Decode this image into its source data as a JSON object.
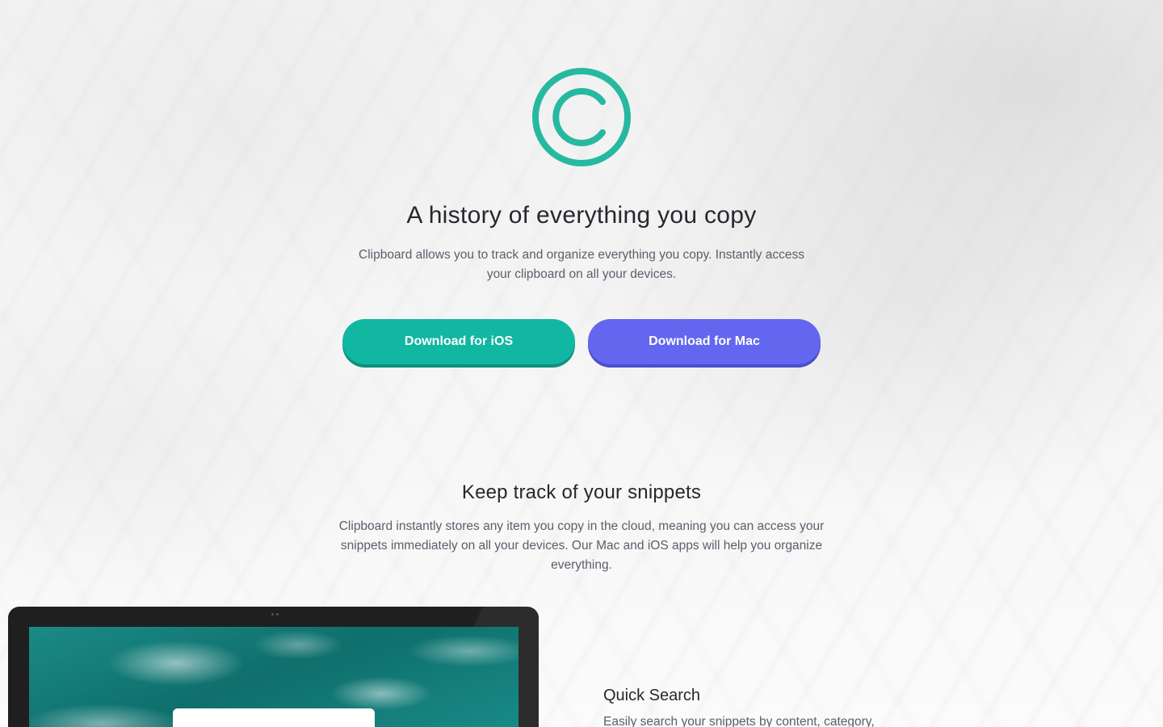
{
  "hero": {
    "logo_icon": "copyright-c-icon",
    "title": "A history of everything you copy",
    "subtitle": "Clipboard allows you to track and organize everything you copy. Instantly access your clipboard on all your devices.",
    "buttons": {
      "ios_label": "Download for iOS",
      "mac_label": "Download for Mac"
    }
  },
  "snippets": {
    "title": "Keep track of your snippets",
    "subtitle": "Clipboard instantly stores any item you copy in the cloud, meaning you can access your snippets immediately on all your devices. Our Mac and iOS apps will help you organize everything."
  },
  "features": [
    {
      "title": "Quick Search",
      "description": "Easily search your snippets by content, category,"
    }
  ],
  "colors": {
    "accent_teal": "#12b7a1",
    "accent_indigo": "#6366ef",
    "heading": "#25282d",
    "body_text": "#5b5e6b"
  }
}
